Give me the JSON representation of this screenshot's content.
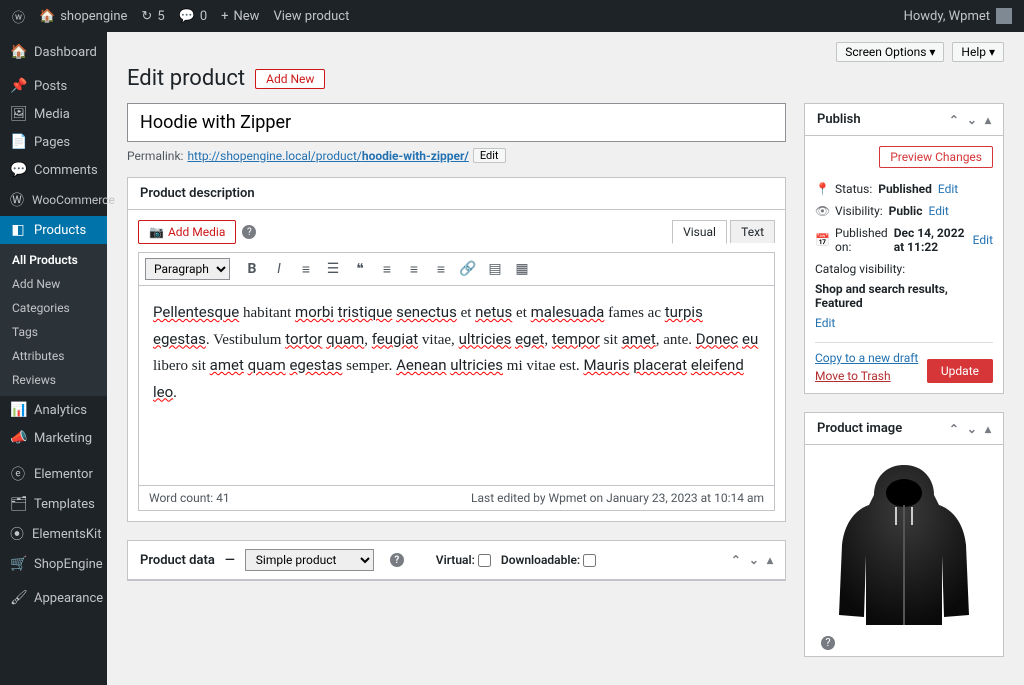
{
  "topbar": {
    "site": "shopengine",
    "updates": "5",
    "comments": "0",
    "new": "New",
    "view": "View product",
    "howdy": "Howdy, Wpmet"
  },
  "sidebar": {
    "items": [
      {
        "label": "Dashboard",
        "icon": "⏱"
      },
      {
        "label": "Posts",
        "icon": "📌"
      },
      {
        "label": "Media",
        "icon": "🎵"
      },
      {
        "label": "Pages",
        "icon": "📄"
      },
      {
        "label": "Comments",
        "icon": "💬"
      },
      {
        "label": "WooCommerce",
        "icon": "W"
      },
      {
        "label": "Products",
        "icon": "◧"
      },
      {
        "label": "Analytics",
        "icon": "📊"
      },
      {
        "label": "Marketing",
        "icon": "📣"
      },
      {
        "label": "Elementor",
        "icon": "ⓔ"
      },
      {
        "label": "Templates",
        "icon": "🗂"
      },
      {
        "label": "ElementsKit",
        "icon": "⦿"
      },
      {
        "label": "ShopEngine",
        "icon": "🛒"
      },
      {
        "label": "Appearance",
        "icon": "🖌"
      }
    ],
    "submenu": [
      "All Products",
      "Add New",
      "Categories",
      "Tags",
      "Attributes",
      "Reviews"
    ]
  },
  "screen_options": "Screen Options ▾",
  "help": "Help ▾",
  "page": {
    "title": "Edit product",
    "addnew": "Add New",
    "product_title": "Hoodie with Zipper",
    "permalink_label": "Permalink:",
    "permalink_base": "http://shopengine.local/product/",
    "permalink_slug": "hoodie-with-zipper/",
    "edit": "Edit"
  },
  "desc": {
    "title": "Product description",
    "addmedia": "Add Media",
    "visual": "Visual",
    "text": "Text",
    "paragraph": "Paragraph",
    "content_tokens": [
      {
        "t": "Pellentesque",
        "u": true
      },
      {
        "t": " habitant "
      },
      {
        "t": "morbi",
        "u": true
      },
      {
        "t": " "
      },
      {
        "t": "tristique",
        "u": true
      },
      {
        "t": " "
      },
      {
        "t": "senectus",
        "u": true
      },
      {
        "t": " et "
      },
      {
        "t": "netus",
        "u": true
      },
      {
        "t": " et "
      },
      {
        "t": "malesuada",
        "u": true
      },
      {
        "t": " fames ac "
      },
      {
        "t": "turpis",
        "u": true
      },
      {
        "t": " "
      },
      {
        "t": "egestas",
        "u": true
      },
      {
        "t": ". Vestibulum "
      },
      {
        "t": "tortor",
        "u": true
      },
      {
        "t": " "
      },
      {
        "t": "quam",
        "u": true
      },
      {
        "t": ", "
      },
      {
        "t": "feugiat",
        "u": true
      },
      {
        "t": " vitae, "
      },
      {
        "t": "ultricies",
        "u": true
      },
      {
        "t": " "
      },
      {
        "t": "eget",
        "u": true
      },
      {
        "t": ", "
      },
      {
        "t": "tempor",
        "u": true
      },
      {
        "t": " sit "
      },
      {
        "t": "amet",
        "u": true
      },
      {
        "t": ", ante. "
      },
      {
        "t": "Donec",
        "u": true
      },
      {
        "t": " "
      },
      {
        "t": "eu",
        "u": true
      },
      {
        "t": " libero sit "
      },
      {
        "t": "amet",
        "u": true
      },
      {
        "t": " "
      },
      {
        "t": "quam",
        "u": true
      },
      {
        "t": " "
      },
      {
        "t": "egestas",
        "u": true
      },
      {
        "t": " semper. "
      },
      {
        "t": "Aenean",
        "u": true
      },
      {
        "t": " "
      },
      {
        "t": "ultricies",
        "u": true
      },
      {
        "t": " mi vitae est. "
      },
      {
        "t": "Mauris",
        "u": true
      },
      {
        "t": " "
      },
      {
        "t": "placerat",
        "u": true
      },
      {
        "t": " "
      },
      {
        "t": "eleifend",
        "u": true
      },
      {
        "t": " "
      },
      {
        "t": "leo",
        "u": true
      },
      {
        "t": "."
      }
    ],
    "wordcount": "Word count: 41",
    "lastedit": "Last edited by Wpmet on January 23, 2023 at 10:14 am"
  },
  "pdata": {
    "title": "Product data",
    "dash": "—",
    "type": "Simple product",
    "virtual": "Virtual:",
    "downloadable": "Downloadable:"
  },
  "publish": {
    "title": "Publish",
    "preview": "Preview Changes",
    "status_label": "Status:",
    "status_value": "Published",
    "visibility_label": "Visibility:",
    "visibility_value": "Public",
    "published_label": "Published on:",
    "published_value": "Dec 14, 2022 at 11:22",
    "catalog_label": "Catalog visibility:",
    "catalog_value": "Shop and search results, Featured",
    "edit": "Edit",
    "copy": "Copy to a new draft",
    "trash": "Move to Trash",
    "update": "Update"
  },
  "pimage": {
    "title": "Product image"
  }
}
